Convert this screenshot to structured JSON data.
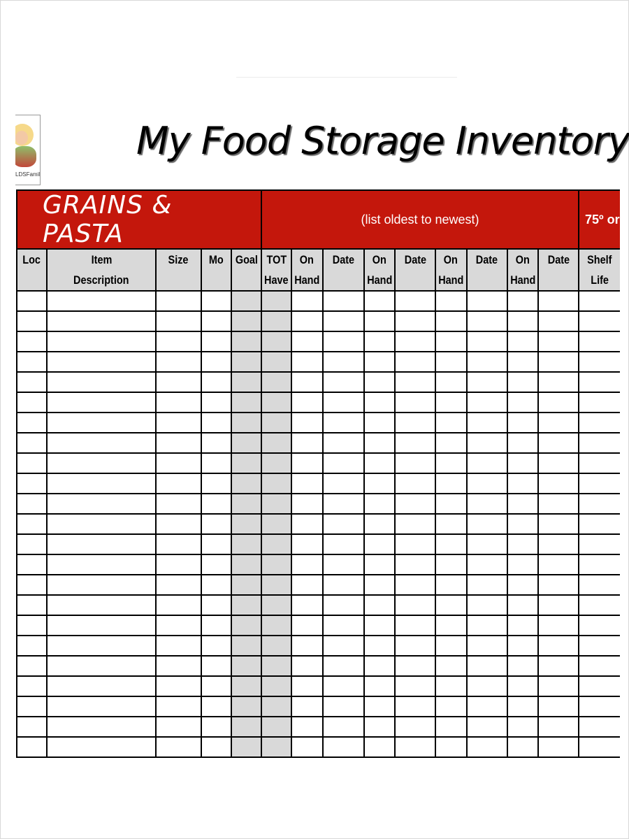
{
  "logo": {
    "text": "LDSFamily"
  },
  "title": "My Food Storage Inventory",
  "section": {
    "name": "GRAINS & PASTA",
    "note": "(list oldest to newest)",
    "temperature": "75º or"
  },
  "columns": [
    {
      "l1": "Loc",
      "l2": ""
    },
    {
      "l1": "Item",
      "l2": "Description"
    },
    {
      "l1": "Size",
      "l2": ""
    },
    {
      "l1": "Mo",
      "l2": ""
    },
    {
      "l1": "Goal",
      "l2": ""
    },
    {
      "l1": "TOT",
      "l2": "Have"
    },
    {
      "l1": "On",
      "l2": "Hand"
    },
    {
      "l1": "Date",
      "l2": ""
    },
    {
      "l1": "On",
      "l2": "Hand"
    },
    {
      "l1": "Date",
      "l2": ""
    },
    {
      "l1": "On",
      "l2": "Hand"
    },
    {
      "l1": "Date",
      "l2": ""
    },
    {
      "l1": "On",
      "l2": "Hand"
    },
    {
      "l1": "Date",
      "l2": ""
    },
    {
      "l1": "Shelf",
      "l2": "Life"
    }
  ],
  "row_count": 23,
  "colors": {
    "section_bg": "#c4170c",
    "header_bg": "#d9d9d9",
    "shaded_columns": "#d9d9d9"
  }
}
